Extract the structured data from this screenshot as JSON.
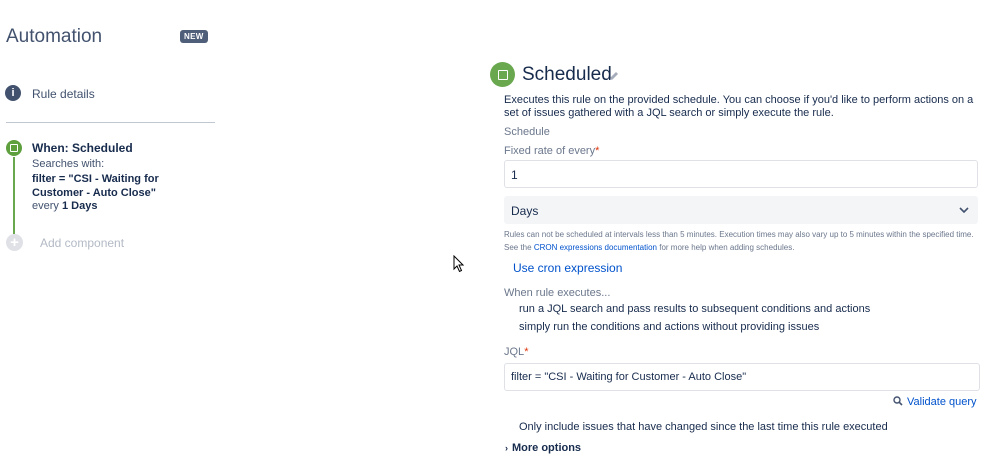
{
  "sidebar": {
    "title": "Automation",
    "badge": "NEW",
    "rule_details_label": "Rule details",
    "trigger": {
      "title": "When: Scheduled",
      "searches_label": "Searches with:",
      "filter": "filter = \"CSI - Waiting for Customer - Auto Close\"",
      "every_prefix": "every",
      "every_value": "1 Days"
    },
    "add_component_label": "Add component"
  },
  "panel": {
    "title": "Scheduled",
    "description": "Executes this rule on the provided schedule. You can choose if you'd like to perform actions on a set of issues gathered with a JQL search or simply execute the rule.",
    "schedule_label": "Schedule",
    "fixed_rate_label": "Fixed rate of every",
    "fixed_rate_value": "1",
    "unit_value": "Days",
    "note_line1": "Rules can not be scheduled at intervals less than 5 minutes. Execution times may also vary up to 5 minutes within the specified time.",
    "note_see": "See the",
    "note_link": "CRON expressions documentation",
    "note_rest": "for more help when adding schedules.",
    "cron_link": "Use cron expression",
    "when_executes_label": "When rule executes...",
    "option_jql": "run a JQL search and pass results to subsequent conditions and actions",
    "option_simple": "simply run the conditions and actions without providing issues",
    "jql_label": "JQL",
    "jql_value": "filter = \"CSI - Waiting for Customer - Auto Close\"",
    "validate_label": "Validate query",
    "only_changed": "Only include issues that have changed since the last time this rule executed",
    "more_options": "More options"
  },
  "colors": {
    "green": "#6aa84f",
    "link": "#0052cc",
    "required": "#de350b"
  }
}
